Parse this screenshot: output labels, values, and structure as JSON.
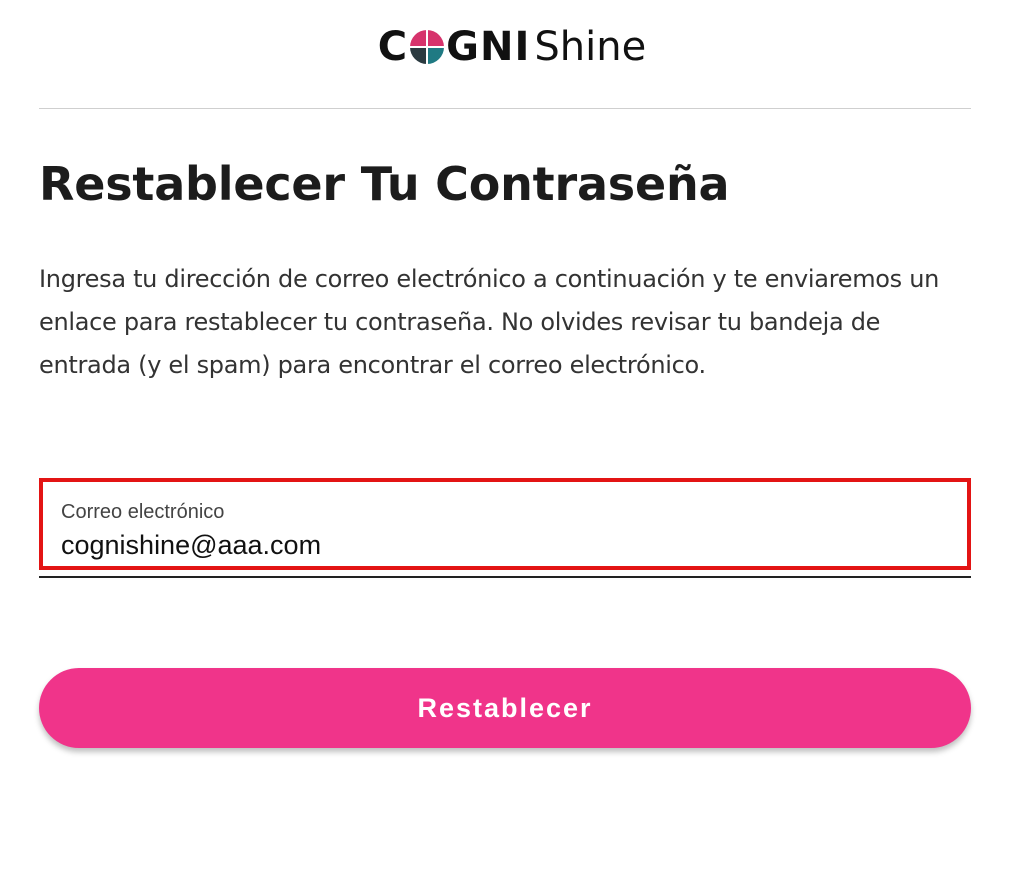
{
  "logo": {
    "part1": "C",
    "part2": "GNI",
    "part3": "Shine",
    "colors": {
      "pink": "#d6336c",
      "teal": "#1f7a83",
      "dark": "#2b3a40"
    }
  },
  "page": {
    "title": "Restablecer Tu Contraseña",
    "description": "Ingresa tu dirección de correo electrónico a continuación y te enviaremos un enlace para restablecer tu contraseña. No olvides revisar tu bandeja de entrada (y el spam) para encontrar el correo electrónico."
  },
  "email_field": {
    "label": "Correo electrónico",
    "value": "cognishine@aaa.com",
    "highlight_color": "#e31414"
  },
  "submit": {
    "label": "Restablecer",
    "color": "#f0348a"
  }
}
